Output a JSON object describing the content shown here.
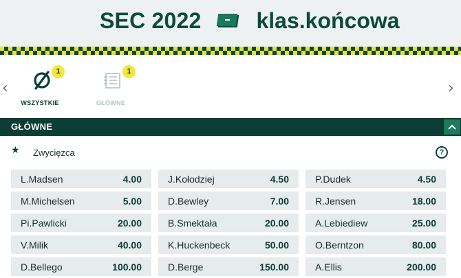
{
  "header": {
    "event_title": "SEC 2022",
    "market_title": "klas.końcowa",
    "flag_icon": "flag-icon"
  },
  "tabs": [
    {
      "label": "WSZYSTKIE",
      "badge": "1",
      "icon": "no-filter-icon",
      "active": true
    },
    {
      "label": "GŁÓWNE",
      "badge": "1",
      "icon": "list-icon",
      "active": false
    }
  ],
  "nav": {
    "left_icon": "chevron-left-icon",
    "right_icon": "chevron-right-icon"
  },
  "section": {
    "title": "GŁÓWNE",
    "collapse_icon": "chevron-up-icon"
  },
  "market": {
    "name": "Zwycięzca",
    "star_icon": "star-icon",
    "help_icon": "help-icon",
    "help_glyph": "?"
  },
  "odds": [
    [
      {
        "name": "L.Madsen",
        "price": "4.00"
      },
      {
        "name": "J.Kołodziej",
        "price": "4.50"
      },
      {
        "name": "P.Dudek",
        "price": "4.50"
      }
    ],
    [
      {
        "name": "M.Michelsen",
        "price": "5.00"
      },
      {
        "name": "D.Bewley",
        "price": "7.00"
      },
      {
        "name": "R.Jensen",
        "price": "18.00"
      }
    ],
    [
      {
        "name": "Pi.Pawlicki",
        "price": "20.00"
      },
      {
        "name": "B.Smektała",
        "price": "20.00"
      },
      {
        "name": "A.Lebiediew",
        "price": "25.00"
      }
    ],
    [
      {
        "name": "V.Milik",
        "price": "40.00"
      },
      {
        "name": "K.Huckenbeck",
        "price": "50.00"
      },
      {
        "name": "O.Berntzon",
        "price": "80.00"
      }
    ],
    [
      {
        "name": "D.Bellego",
        "price": "100.00"
      },
      {
        "name": "D.Berge",
        "price": "150.00"
      },
      {
        "name": "A.Ellis",
        "price": "200.00"
      }
    ]
  ],
  "colors": {
    "brand_dark": "#0b3d35",
    "brand_green": "#1d7a5a",
    "accent_yellow": "#f5e53c",
    "cell_bg": "#e6ebed"
  }
}
